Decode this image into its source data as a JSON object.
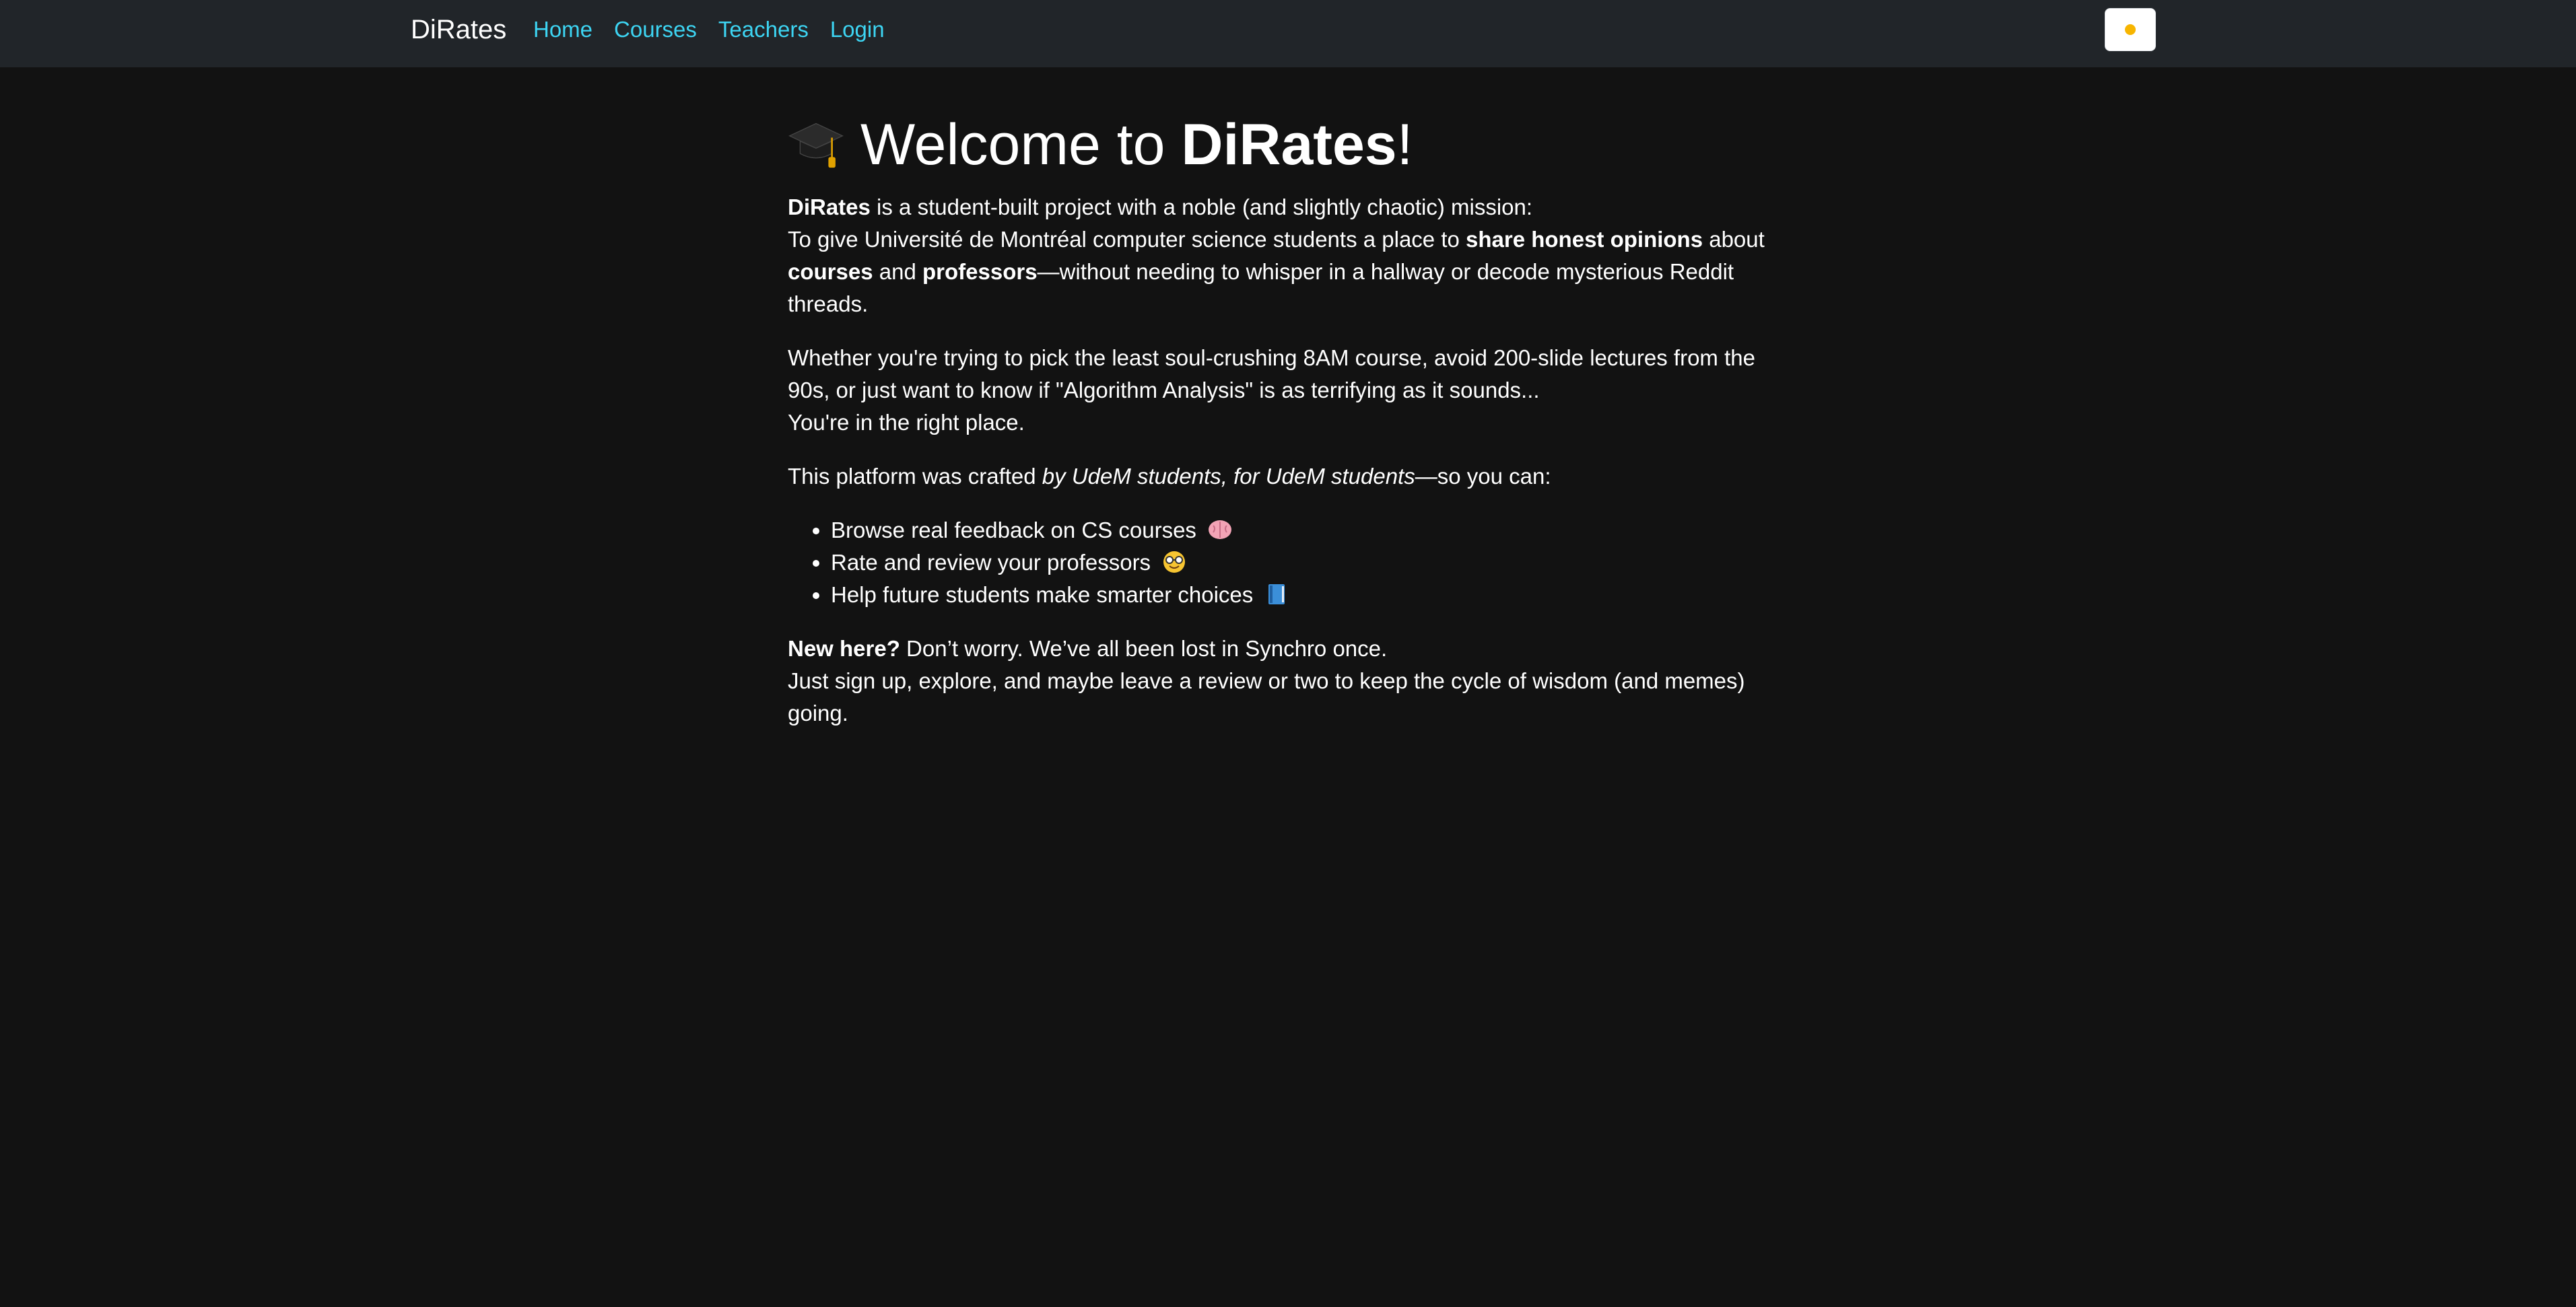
{
  "nav": {
    "brand": "DiRates",
    "links": [
      "Home",
      "Courses",
      "Teachers",
      "Login"
    ],
    "theme_toggle_icon": "sun-icon"
  },
  "main": {
    "title_prefix": "Welcome to ",
    "title_brand": "DiRates",
    "title_suffix": "!",
    "title_icon": "graduation-cap-icon",
    "intro": {
      "brand": "DiRates",
      "line1_rest": " is a student-built project with a noble (and slightly chaotic) mission:",
      "line2_a": "To give Université de Montréal computer science students a place to ",
      "line2_b_bold": "share honest opinions",
      "line2_c": " about ",
      "line2_d_bold": "courses",
      "line2_e": " and ",
      "line2_f_bold": "professors",
      "line2_g": "—without needing to whisper in a hallway or decode mysterious Reddit threads."
    },
    "para2_line1": "Whether you're trying to pick the least soul-crushing 8AM course, avoid 200-slide lectures from the 90s, or just want to know if \"Algorithm Analysis\" is as terrifying as it sounds...",
    "para2_line2": "You're in the right place.",
    "para3_a": "This platform was crafted ",
    "para3_b_italic": "by UdeM students, for UdeM students",
    "para3_c": "—so you can:",
    "bullets": [
      {
        "text": "Browse real feedback on CS courses",
        "icon": "brain-icon"
      },
      {
        "text": "Rate and review your professors",
        "icon": "nerd-face-icon"
      },
      {
        "text": "Help future students make smarter choices",
        "icon": "blue-book-icon"
      }
    ],
    "para4_bold": "New here?",
    "para4_rest": " Don’t worry. We’ve all been lost in Synchro once.",
    "para4_line2": "Just sign up, explore, and maybe leave a review or two to keep the cycle of wisdom (and memes) going."
  }
}
